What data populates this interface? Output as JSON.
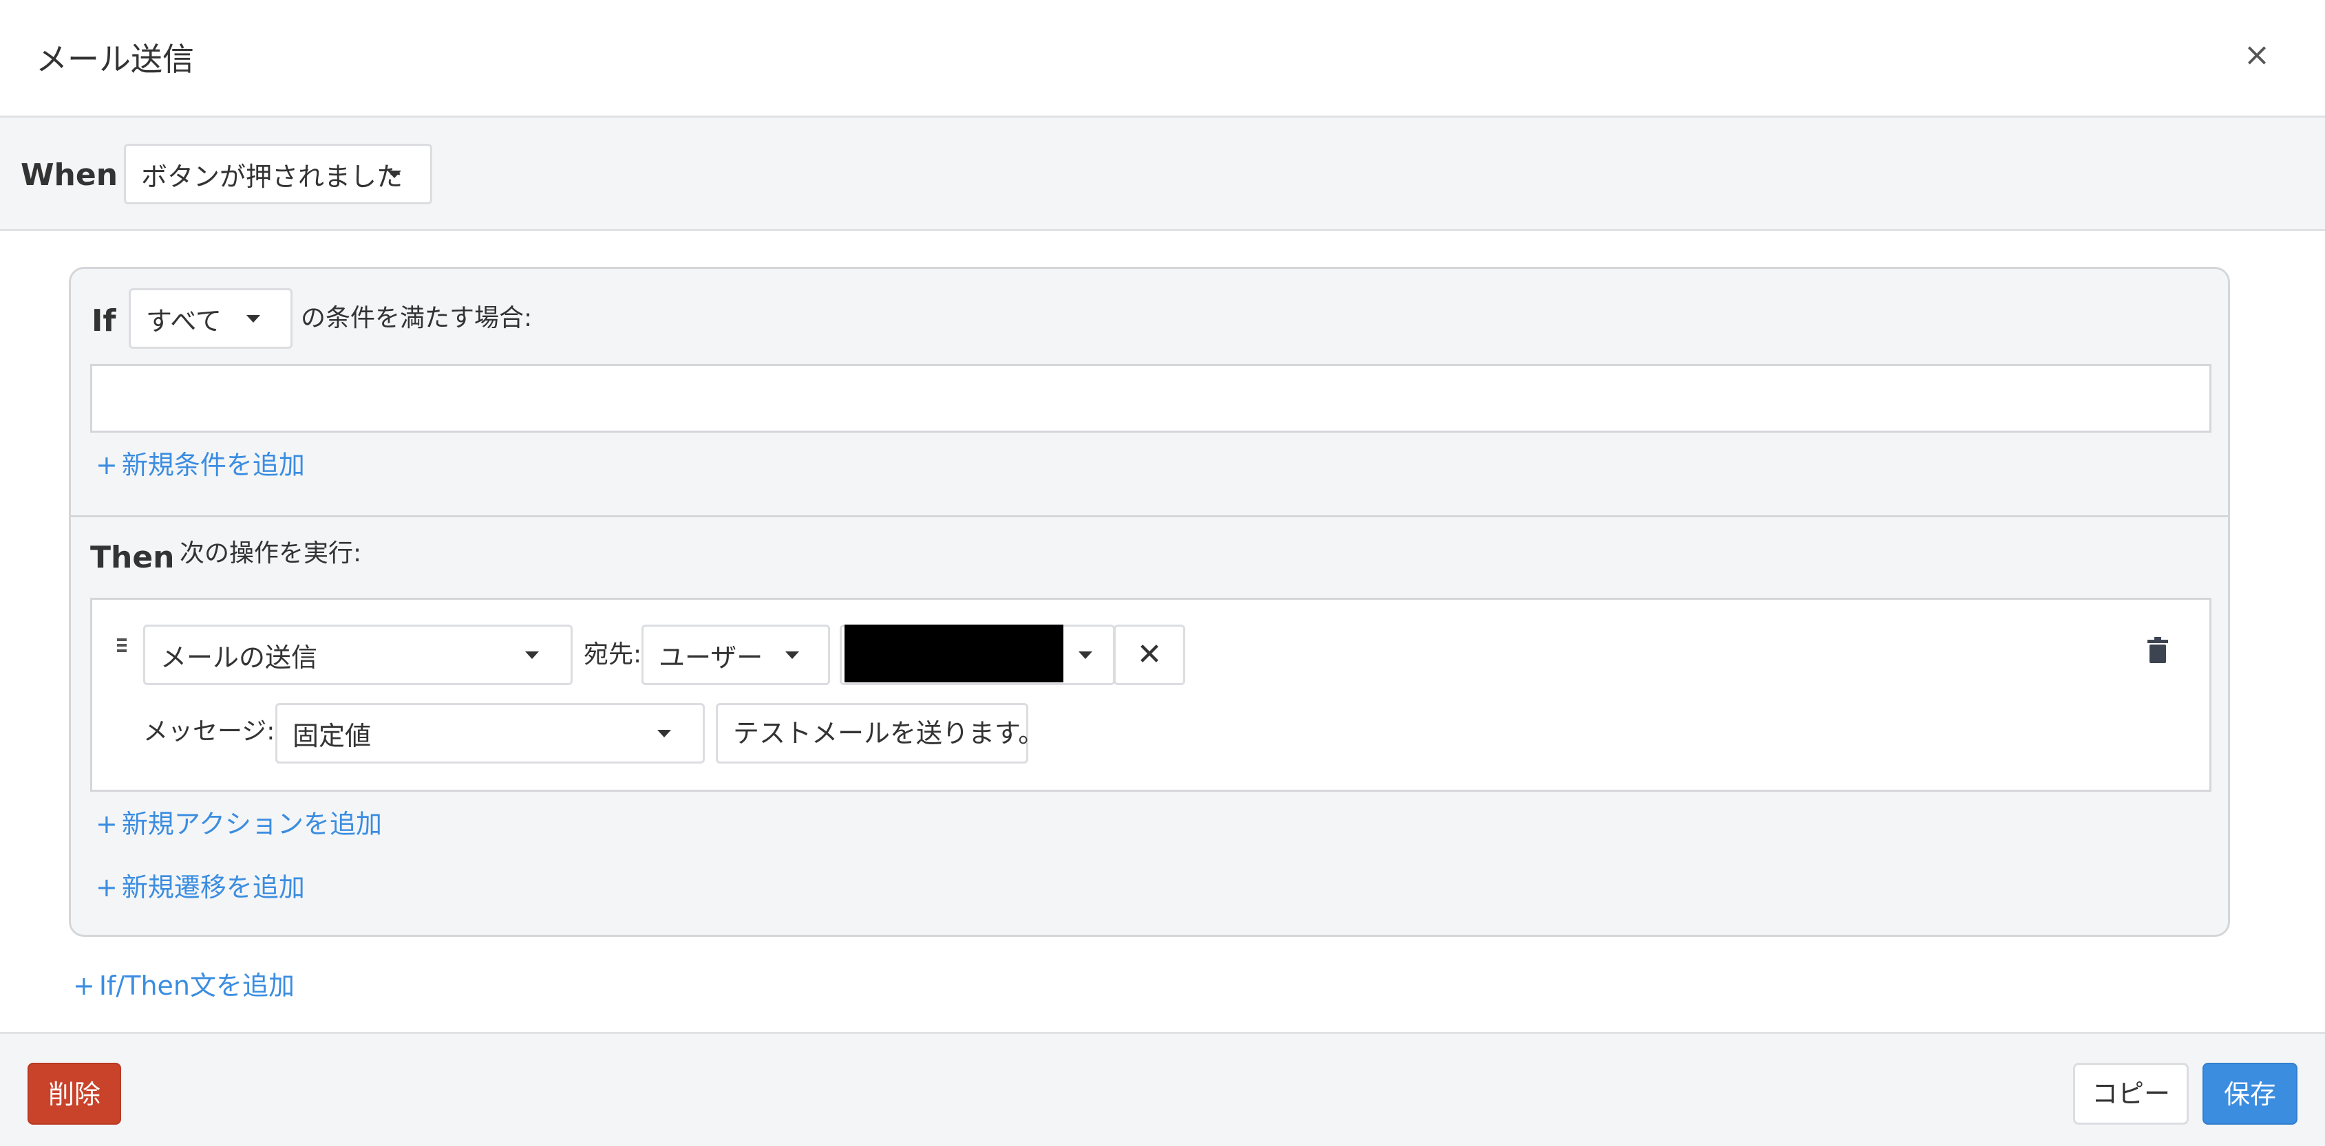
{
  "dialog": {
    "title": "メール送信",
    "close_icon": "×"
  },
  "when": {
    "label": "When",
    "trigger_selected": "ボタンが押されました"
  },
  "if_section": {
    "label": "If",
    "match_selected": "すべて",
    "match_suffix": "の条件を満たす場合:",
    "add_condition": "新規条件を追加"
  },
  "then_section": {
    "label": "Then",
    "description": "次の操作を実行:",
    "action": {
      "type_selected": "メールの送信",
      "recipient_label": "宛先:",
      "recipient_type_selected": "ユーザー",
      "remove_icon": "✕",
      "message_label": "メッセージ:",
      "message_type_selected": "固定値",
      "message_value": "テストメールを送ります。"
    },
    "add_action": "新規アクションを追加",
    "add_transition": "新規遷移を追加"
  },
  "add_if_then": "If/Then文を追加",
  "footer": {
    "delete_label": "削除",
    "copy_label": "コピー",
    "save_label": "保存"
  },
  "colors": {
    "link": "#3b8de0",
    "delete": "#c9422a",
    "save": "#3b8de0",
    "panel_bg": "#f4f5f7"
  },
  "icons": {
    "plus": "+",
    "drag": "drag-handle-icon",
    "trash": "trash-icon",
    "caret": "caret-down-icon"
  }
}
